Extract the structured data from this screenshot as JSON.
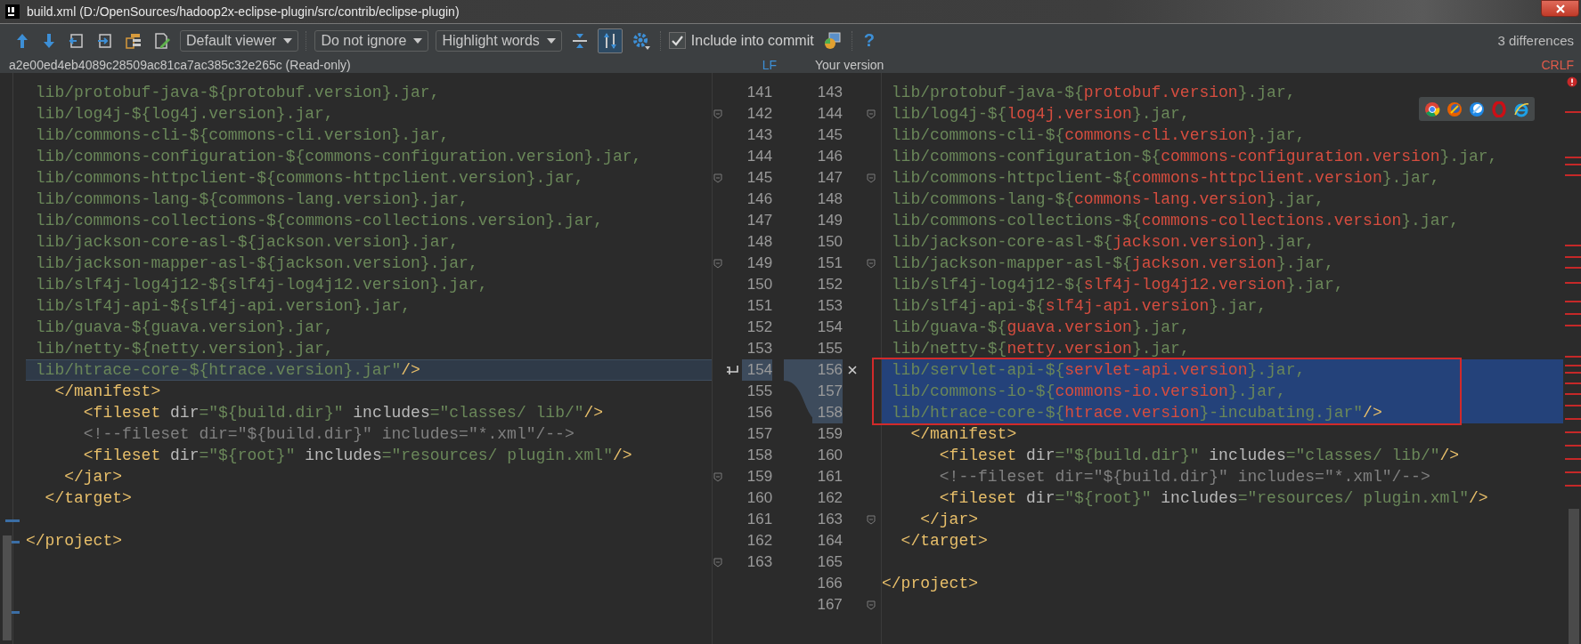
{
  "window": {
    "title": "build.xml (D:/OpenSources/hadoop2x-eclipse-plugin/src/contrib/eclipse-plugin)"
  },
  "toolbar": {
    "viewer": "Default viewer",
    "ignore": "Do not ignore",
    "highlight": "Highlight words",
    "sync_scroll": {
      "selected": true
    },
    "include_into_commit": {
      "label": "Include into commit",
      "checked": true
    },
    "help": "?",
    "differences": "3 differences"
  },
  "left_pane": {
    "header": "a2e00ed4eb4089c28509ac81ca7ac385c32e265c (Read-only)",
    "line_separator": "LF",
    "lines": [
      {
        "number": "141",
        "changed": false,
        "fold": false,
        "segments": [
          {
            "kind": "value",
            "text": " lib/protobuf-java-${protobuf.version}.jar,"
          }
        ]
      },
      {
        "number": "142",
        "changed": false,
        "fold": true,
        "segments": [
          {
            "kind": "value",
            "text": " lib/log4j-${log4j.version}.jar,"
          }
        ]
      },
      {
        "number": "143",
        "changed": false,
        "fold": false,
        "segments": [
          {
            "kind": "value",
            "text": " lib/commons-cli-${commons-cli.version}.jar,"
          }
        ]
      },
      {
        "number": "144",
        "changed": false,
        "fold": false,
        "segments": [
          {
            "kind": "value",
            "text": " lib/commons-configuration-${commons-configuration.version}.jar,"
          }
        ]
      },
      {
        "number": "145",
        "changed": false,
        "fold": true,
        "segments": [
          {
            "kind": "value",
            "text": " lib/commons-httpclient-${commons-httpclient.version}.jar,"
          }
        ]
      },
      {
        "number": "146",
        "changed": false,
        "fold": false,
        "segments": [
          {
            "kind": "value",
            "text": " lib/commons-lang-${commons-lang.version}.jar,"
          }
        ]
      },
      {
        "number": "147",
        "changed": false,
        "fold": false,
        "segments": [
          {
            "kind": "value",
            "text": " lib/commons-collections-${commons-collections.version}.jar,"
          }
        ]
      },
      {
        "number": "148",
        "changed": false,
        "fold": false,
        "segments": [
          {
            "kind": "value",
            "text": " lib/jackson-core-asl-${jackson.version}.jar,"
          }
        ]
      },
      {
        "number": "149",
        "changed": false,
        "fold": true,
        "segments": [
          {
            "kind": "value",
            "text": " lib/jackson-mapper-asl-${jackson.version}.jar,"
          }
        ]
      },
      {
        "number": "150",
        "changed": false,
        "fold": false,
        "segments": [
          {
            "kind": "value",
            "text": " lib/slf4j-log4j12-${slf4j-log4j12.version}.jar,"
          }
        ]
      },
      {
        "number": "151",
        "changed": false,
        "fold": false,
        "segments": [
          {
            "kind": "value",
            "text": " lib/slf4j-api-${slf4j-api.version}.jar,"
          }
        ]
      },
      {
        "number": "152",
        "changed": false,
        "fold": false,
        "segments": [
          {
            "kind": "value",
            "text": " lib/guava-${guava.version}.jar,"
          }
        ]
      },
      {
        "number": "153",
        "changed": false,
        "fold": false,
        "segments": [
          {
            "kind": "value",
            "text": " lib/netty-${netty.version}.jar,"
          }
        ]
      },
      {
        "number": "154",
        "changed": true,
        "fold": false,
        "action_icon": true,
        "segments": [
          {
            "kind": "value",
            "text": " lib/htrace-core-${htrace.version}.jar\""
          },
          {
            "kind": "tag",
            "text": "/>"
          }
        ]
      },
      {
        "number": "155",
        "changed": false,
        "fold": false,
        "segments": [
          {
            "kind": "tag",
            "text": "   </manifest>"
          }
        ]
      },
      {
        "number": "156",
        "changed": false,
        "fold": false,
        "segments": [
          {
            "kind": "tag",
            "text": "      <fileset"
          },
          {
            "kind": "attr",
            "text": " dir"
          },
          {
            "kind": "value",
            "text": "=\"${build.dir}\""
          },
          {
            "kind": "attr",
            "text": " includes"
          },
          {
            "kind": "value",
            "text": "=\"classes/ lib/\""
          },
          {
            "kind": "tag",
            "text": "/>"
          }
        ]
      },
      {
        "number": "157",
        "changed": false,
        "fold": false,
        "segments": [
          {
            "kind": "comment",
            "text": "      <!--fileset dir=\"${build.dir}\" includes=\"*.xml\"/-->"
          }
        ]
      },
      {
        "number": "158",
        "changed": false,
        "fold": false,
        "segments": [
          {
            "kind": "tag",
            "text": "      <fileset"
          },
          {
            "kind": "attr",
            "text": " dir"
          },
          {
            "kind": "value",
            "text": "=\"${root}\""
          },
          {
            "kind": "attr",
            "text": " includes"
          },
          {
            "kind": "value",
            "text": "=\"resources/ plugin.xml\""
          },
          {
            "kind": "tag",
            "text": "/>"
          }
        ]
      },
      {
        "number": "159",
        "changed": false,
        "fold": true,
        "segments": [
          {
            "kind": "tag",
            "text": "    </jar>"
          }
        ]
      },
      {
        "number": "160",
        "changed": false,
        "fold": false,
        "segments": [
          {
            "kind": "tag",
            "text": "  </target>"
          }
        ]
      },
      {
        "number": "161",
        "changed": false,
        "fold": false
      },
      {
        "number": "162",
        "changed": false,
        "fold": false,
        "segments": [
          {
            "kind": "tag",
            "text": "</project>"
          }
        ]
      },
      {
        "number": "163",
        "changed": false,
        "fold": true
      }
    ]
  },
  "right_pane": {
    "header": "Your version",
    "line_separator": "CRLF",
    "lines": [
      {
        "number": "143",
        "changed": false,
        "fold": false,
        "segments": [
          {
            "kind": "value",
            "text": " lib/protobuf-java-${"
          },
          {
            "kind": "variable",
            "text": "protobuf.version"
          },
          {
            "kind": "value",
            "text": "}.jar,"
          }
        ]
      },
      {
        "number": "144",
        "changed": false,
        "fold": true,
        "segments": [
          {
            "kind": "value",
            "text": " lib/log4j-${"
          },
          {
            "kind": "variable",
            "text": "log4j.version"
          },
          {
            "kind": "value",
            "text": "}.jar,"
          }
        ]
      },
      {
        "number": "145",
        "changed": false,
        "fold": false,
        "segments": [
          {
            "kind": "value",
            "text": " lib/commons-cli-${"
          },
          {
            "kind": "variable",
            "text": "commons-cli.version"
          },
          {
            "kind": "value",
            "text": "}.jar,"
          }
        ]
      },
      {
        "number": "146",
        "changed": false,
        "fold": false,
        "segments": [
          {
            "kind": "value",
            "text": " lib/commons-configuration-${"
          },
          {
            "kind": "variable",
            "text": "commons-configuration.version"
          },
          {
            "kind": "value",
            "text": "}.jar,"
          }
        ]
      },
      {
        "number": "147",
        "changed": false,
        "fold": true,
        "segments": [
          {
            "kind": "value",
            "text": " lib/commons-httpclient-${"
          },
          {
            "kind": "variable",
            "text": "commons-httpclient.version"
          },
          {
            "kind": "value",
            "text": "}.jar,"
          }
        ]
      },
      {
        "number": "148",
        "changed": false,
        "fold": false,
        "segments": [
          {
            "kind": "value",
            "text": " lib/commons-lang-${"
          },
          {
            "kind": "variable",
            "text": "commons-lang.version"
          },
          {
            "kind": "value",
            "text": "}.jar,"
          }
        ]
      },
      {
        "number": "149",
        "changed": false,
        "fold": false,
        "segments": [
          {
            "kind": "value",
            "text": " lib/commons-collections-${"
          },
          {
            "kind": "variable",
            "text": "commons-collections.version"
          },
          {
            "kind": "value",
            "text": "}.jar,"
          }
        ]
      },
      {
        "number": "150",
        "changed": false,
        "fold": false,
        "segments": [
          {
            "kind": "value",
            "text": " lib/jackson-core-asl-${"
          },
          {
            "kind": "variable",
            "text": "jackson.version"
          },
          {
            "kind": "value",
            "text": "}.jar,"
          }
        ]
      },
      {
        "number": "151",
        "changed": false,
        "fold": true,
        "segments": [
          {
            "kind": "value",
            "text": " lib/jackson-mapper-asl-${"
          },
          {
            "kind": "variable",
            "text": "jackson.version"
          },
          {
            "kind": "value",
            "text": "}.jar,"
          }
        ]
      },
      {
        "number": "152",
        "changed": false,
        "fold": false,
        "segments": [
          {
            "kind": "value",
            "text": " lib/slf4j-log4j12-${"
          },
          {
            "kind": "variable",
            "text": "slf4j-log4j12.version"
          },
          {
            "kind": "value",
            "text": "}.jar,"
          }
        ]
      },
      {
        "number": "153",
        "changed": false,
        "fold": false,
        "segments": [
          {
            "kind": "value",
            "text": " lib/slf4j-api-${"
          },
          {
            "kind": "variable",
            "text": "slf4j-api.version"
          },
          {
            "kind": "value",
            "text": "}.jar,"
          }
        ]
      },
      {
        "number": "154",
        "changed": false,
        "fold": false,
        "segments": [
          {
            "kind": "value",
            "text": " lib/guava-${"
          },
          {
            "kind": "variable",
            "text": "guava.version"
          },
          {
            "kind": "value",
            "text": "}.jar,"
          }
        ]
      },
      {
        "number": "155",
        "changed": false,
        "fold": false,
        "segments": [
          {
            "kind": "value",
            "text": " lib/netty-${"
          },
          {
            "kind": "variable",
            "text": "netty.version"
          },
          {
            "kind": "value",
            "text": "}.jar,"
          }
        ]
      },
      {
        "number": "156",
        "changed": true,
        "fold": false,
        "action_icon": true,
        "segments": [
          {
            "kind": "value",
            "text": " lib/servlet-api-${"
          },
          {
            "kind": "variable",
            "text": "servlet-api.version"
          },
          {
            "kind": "value",
            "text": "}.jar,"
          }
        ]
      },
      {
        "number": "157",
        "changed": true,
        "fold": false,
        "segments": [
          {
            "kind": "value",
            "text": " lib/commons-io-${"
          },
          {
            "kind": "variable",
            "text": "commons-io.version"
          },
          {
            "kind": "value",
            "text": "}.jar,"
          }
        ]
      },
      {
        "number": "158",
        "changed": true,
        "fold": false,
        "segments": [
          {
            "kind": "value",
            "text": " lib/htrace-core-${"
          },
          {
            "kind": "variable",
            "text": "htrace.version"
          },
          {
            "kind": "value",
            "text": "}-incubating.jar\""
          },
          {
            "kind": "tag",
            "text": "/>"
          }
        ]
      },
      {
        "number": "159",
        "changed": false,
        "fold": false,
        "segments": [
          {
            "kind": "tag",
            "text": "   </manifest>"
          }
        ]
      },
      {
        "number": "160",
        "changed": false,
        "fold": false,
        "segments": [
          {
            "kind": "tag",
            "text": "      <fileset"
          },
          {
            "kind": "attr",
            "text": " dir"
          },
          {
            "kind": "value",
            "text": "=\"${build.dir}\""
          },
          {
            "kind": "attr",
            "text": " includes"
          },
          {
            "kind": "value",
            "text": "=\"classes/ lib/\""
          },
          {
            "kind": "tag",
            "text": "/>"
          }
        ]
      },
      {
        "number": "161",
        "changed": false,
        "fold": false,
        "segments": [
          {
            "kind": "comment",
            "text": "      <!--fileset dir=\"${build.dir}\" includes=\"*.xml\"/-->"
          }
        ]
      },
      {
        "number": "162",
        "changed": false,
        "fold": false,
        "segments": [
          {
            "kind": "tag",
            "text": "      <fileset"
          },
          {
            "kind": "attr",
            "text": " dir"
          },
          {
            "kind": "value",
            "text": "=\"${root}\""
          },
          {
            "kind": "attr",
            "text": " includes"
          },
          {
            "kind": "value",
            "text": "=\"resources/ plugin.xml\""
          },
          {
            "kind": "tag",
            "text": "/>"
          }
        ]
      },
      {
        "number": "163",
        "changed": false,
        "fold": true,
        "segments": [
          {
            "kind": "tag",
            "text": "    </jar>"
          }
        ]
      },
      {
        "number": "164",
        "changed": false,
        "fold": false,
        "segments": [
          {
            "kind": "tag",
            "text": "  </target>"
          }
        ]
      },
      {
        "number": "165",
        "changed": false,
        "fold": false
      },
      {
        "number": "166",
        "changed": false,
        "fold": false,
        "segments": [
          {
            "kind": "tag",
            "text": "</project>"
          }
        ]
      },
      {
        "number": "167",
        "changed": false,
        "fold": true
      }
    ]
  }
}
